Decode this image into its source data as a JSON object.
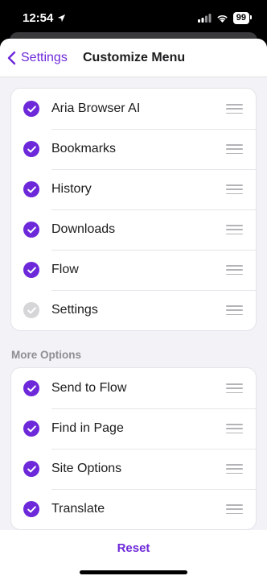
{
  "status_bar": {
    "time": "12:54",
    "battery": "99",
    "icons": [
      "location-arrow-icon",
      "cellular-signal-icon",
      "wifi-icon",
      "battery-icon"
    ]
  },
  "nav": {
    "back_label": "Settings",
    "title": "Customize Menu"
  },
  "main_group": [
    {
      "label": "Aria Browser AI",
      "checked": true
    },
    {
      "label": "Bookmarks",
      "checked": true
    },
    {
      "label": "History",
      "checked": true
    },
    {
      "label": "Downloads",
      "checked": true
    },
    {
      "label": "Flow",
      "checked": true
    },
    {
      "label": "Settings",
      "checked": false
    }
  ],
  "more_options": {
    "header": "More Options",
    "items": [
      {
        "label": "Send to Flow",
        "checked": true
      },
      {
        "label": "Find in Page",
        "checked": true
      },
      {
        "label": "Site Options",
        "checked": true
      },
      {
        "label": "Translate",
        "checked": true
      }
    ]
  },
  "footer": {
    "reset_label": "Reset"
  },
  "colors": {
    "accent": "#6d28d9",
    "unchecked": "#d6d6d9",
    "background": "#f2f2f7"
  }
}
